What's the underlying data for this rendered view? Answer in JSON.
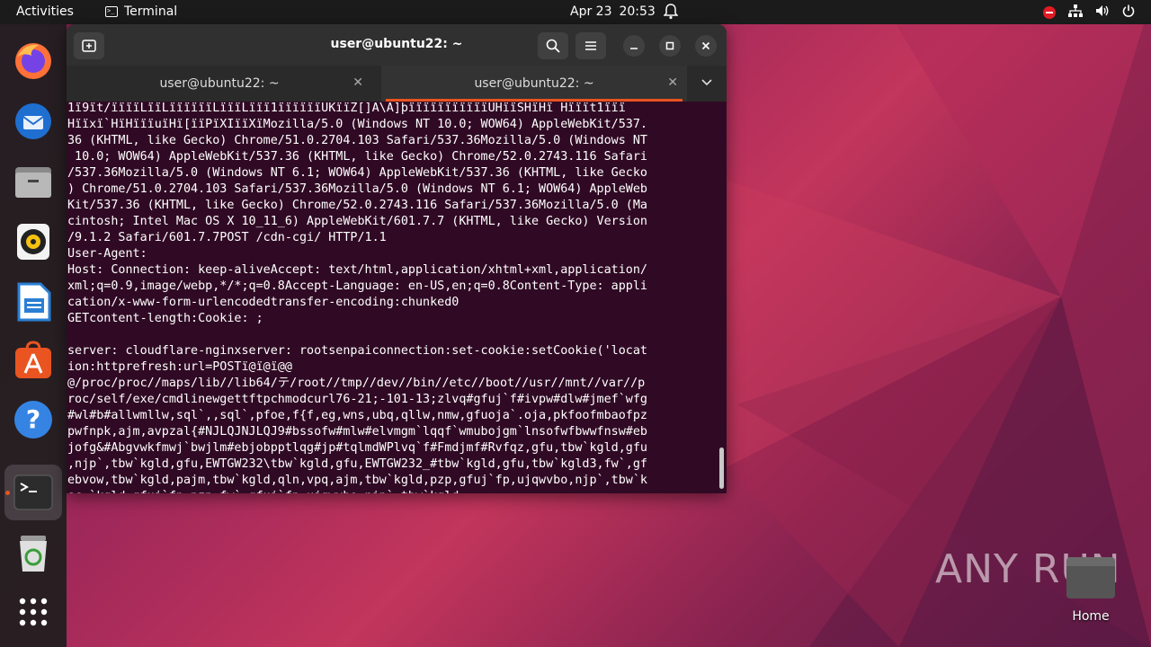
{
  "topbar": {
    "activities": "Activities",
    "app_name": "Terminal",
    "date": "Apr 23",
    "time": "20:53"
  },
  "dock": {
    "items": [
      "firefox-icon",
      "thunderbird-icon",
      "files-icon",
      "rhythmbox-icon",
      "libreoffice-writer-icon",
      "app-center-icon",
      "help-icon",
      "terminal-icon",
      "trash-icon",
      "show-apps-icon"
    ]
  },
  "window": {
    "title": "user@ubuntu22: ~",
    "tabs": [
      {
        "label": "user@ubuntu22: ~"
      },
      {
        "label": "user@ubuntu22: ~"
      }
    ],
    "terminal_text": "1ï9ït/ïïïïLïïLïïïïïïLïïïLïïï1ïïïïïïUKïïZ[]A\\A]þïïïïïïïïïïïUHïïSHïHï Hïïït1ïïï\nHïïxï`HïHïïïuïHï[ïïPïXIïïXïMozilla/5.0 (Windows NT 10.0; WOW64) AppleWebKit/537.\n36 (KHTML, like Gecko) Chrome/51.0.2704.103 Safari/537.36Mozilla/5.0 (Windows NT\n 10.0; WOW64) AppleWebKit/537.36 (KHTML, like Gecko) Chrome/52.0.2743.116 Safari\n/537.36Mozilla/5.0 (Windows NT 6.1; WOW64) AppleWebKit/537.36 (KHTML, like Gecko\n) Chrome/51.0.2704.103 Safari/537.36Mozilla/5.0 (Windows NT 6.1; WOW64) AppleWeb\nKit/537.36 (KHTML, like Gecko) Chrome/52.0.2743.116 Safari/537.36Mozilla/5.0 (Ma\ncintosh; Intel Mac OS X 10_11_6) AppleWebKit/601.7.7 (KHTML, like Gecko) Version\n/9.1.2 Safari/601.7.7POST /cdn-cgi/ HTTP/1.1\nUser-Agent:\nHost: Connection: keep-aliveAccept: text/html,application/xhtml+xml,application/\nxml;q=0.9,image/webp,*/*;q=0.8Accept-Language: en-US,en;q=0.8Content-Type: appli\ncation/x-www-form-urlencodedtransfer-encoding:chunked0\nGETcontent-length:Cookie: ;\n\nserver: cloudflare-nginxserver: rootsenpaiconnection:set-cookie:setCookie('locat\nion:httprefresh:url=POSTï@ï@ï@@\n@/proc/proc//maps/lib//lib64/テ/root//tmp//dev//bin//etc//boot//usr//mnt//var//p\nroc/self/exe/cmdlinewgettftpchmodcurl76-21;-101-13;zlvq#gfuj`f#ivpw#dlw#jmef`wfg\n#wl#b#allwmllw,sql`,,sql`,pfoe,f{f,eg,wns,ubq,qllw,nmw,gfuoja`.oja,pkfoofmbaofpz\npwfnpk,ajm,avpzal{#NJLQJNJLQJ9#bssofw#mlw#elvmgm`lqqf`wmubojgm`lnsofwfbwwfnsw#eb\njofg&#Abgvwkfmwj`bwjlm#ebjobpptlqg#jp#tqlmdWPlvq`f#Fmdjmf#Rvfqz,gfu,tbw`kgld,gfu\n,njp`,tbw`kgld,gfu,EWTGW232\\tbw`kgld,gfu,EWTGW232_#tbw`kgld,gfu,tbw`kgld3,fw`,gf\nebvow,tbw`kgld,pajm,tbw`kgld,qln,vpq,ajm,tbw`kgld,pzp,gfuj`fp,ujqwvbo,njp`,tbw`k\nsc `kgld,gfuj`fp,pzp,fw`,gfuj`fp,ujqwvbo,njp`,tbw`kgld"
  },
  "desktop": {
    "home_label": "Home",
    "watermark": "ANY RUN"
  }
}
